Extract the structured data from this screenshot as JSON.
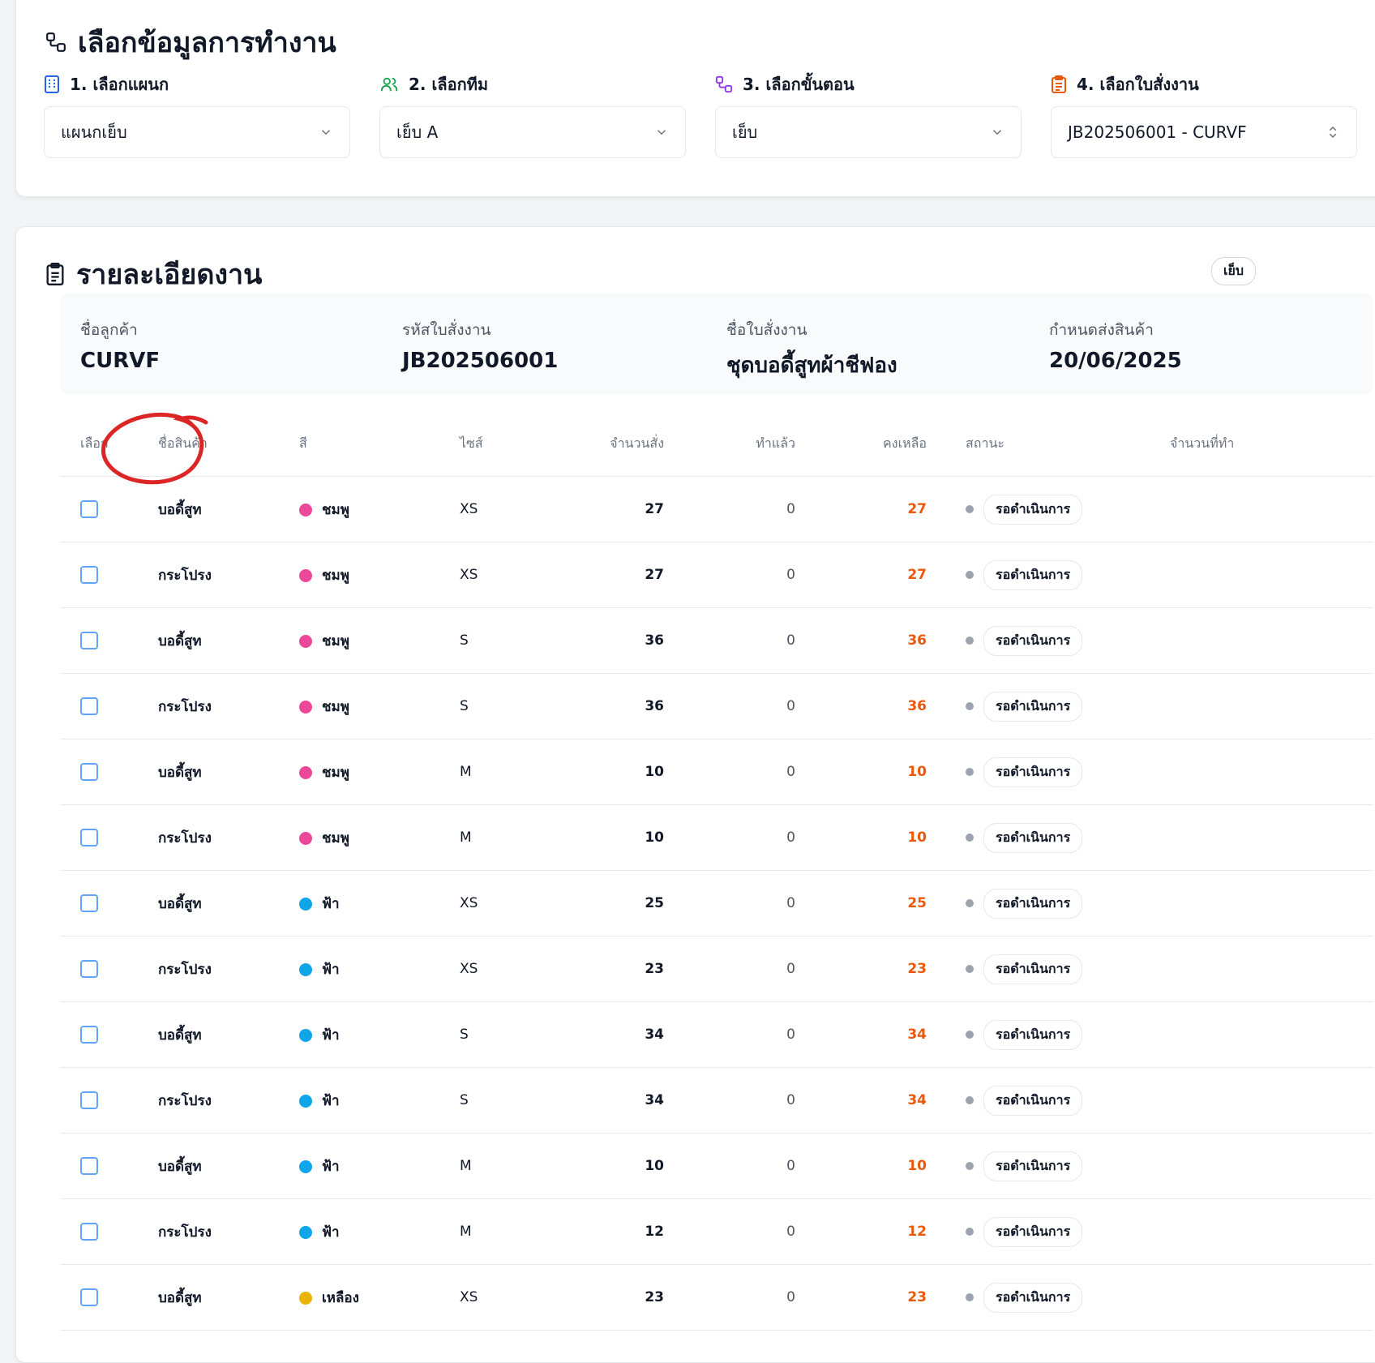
{
  "section1": {
    "title": "เลือกข้อมูลการทำงาน",
    "selects": [
      {
        "label": "1. เลือกแผนก",
        "value": "แผนกเย็บ",
        "icon": "building-icon",
        "color": "#2563eb"
      },
      {
        "label": "2. เลือกทีม",
        "value": "เย็บ A",
        "icon": "users-icon",
        "color": "#16a34a"
      },
      {
        "label": "3. เลือกขั้นตอน",
        "value": "เย็บ",
        "icon": "workflow-icon",
        "color": "#9333ea"
      },
      {
        "label": "4. เลือกใบสั่งงาน",
        "value": "JB202506001 - CURVF",
        "icon": "clipboard-icon",
        "color": "#ea580c"
      }
    ]
  },
  "section2": {
    "title": "รายละเอียดงาน",
    "badge": "เย็บ",
    "info": [
      {
        "label": "ชื่อลูกค้า",
        "value": "CURVF"
      },
      {
        "label": "รหัสใบสั่งงาน",
        "value": "JB202506001"
      },
      {
        "label": "ชื่อใบสั่งงาน",
        "value": "ชุดบอดี้สูทผ้าชีฟอง"
      },
      {
        "label": "กำหนดส่งสินค้า",
        "value": "20/06/2025"
      }
    ]
  },
  "table": {
    "headers": [
      "เลือก",
      "ชื่อสินค้า",
      "สี",
      "ไซส์",
      "จำนวนสั่ง",
      "ทำแล้ว",
      "คงเหลือ",
      "สถานะ",
      "จำนวนที่ทำ"
    ],
    "color_map": {
      "ชมพู": "#ec4899",
      "ฟ้า": "#0ea5e9",
      "เหลือง": "#eab308"
    },
    "rows": [
      {
        "name": "บอดี้สูท",
        "color": "ชมพู",
        "size": "XS",
        "ordered": "27",
        "done": "0",
        "remaining": "27",
        "status": "รอดำเนินการ"
      },
      {
        "name": "กระโปรง",
        "color": "ชมพู",
        "size": "XS",
        "ordered": "27",
        "done": "0",
        "remaining": "27",
        "status": "รอดำเนินการ"
      },
      {
        "name": "บอดี้สูท",
        "color": "ชมพู",
        "size": "S",
        "ordered": "36",
        "done": "0",
        "remaining": "36",
        "status": "รอดำเนินการ"
      },
      {
        "name": "กระโปรง",
        "color": "ชมพู",
        "size": "S",
        "ordered": "36",
        "done": "0",
        "remaining": "36",
        "status": "รอดำเนินการ"
      },
      {
        "name": "บอดี้สูท",
        "color": "ชมพู",
        "size": "M",
        "ordered": "10",
        "done": "0",
        "remaining": "10",
        "status": "รอดำเนินการ"
      },
      {
        "name": "กระโปรง",
        "color": "ชมพู",
        "size": "M",
        "ordered": "10",
        "done": "0",
        "remaining": "10",
        "status": "รอดำเนินการ"
      },
      {
        "name": "บอดี้สูท",
        "color": "ฟ้า",
        "size": "XS",
        "ordered": "25",
        "done": "0",
        "remaining": "25",
        "status": "รอดำเนินการ"
      },
      {
        "name": "กระโปรง",
        "color": "ฟ้า",
        "size": "XS",
        "ordered": "23",
        "done": "0",
        "remaining": "23",
        "status": "รอดำเนินการ"
      },
      {
        "name": "บอดี้สูท",
        "color": "ฟ้า",
        "size": "S",
        "ordered": "34",
        "done": "0",
        "remaining": "34",
        "status": "รอดำเนินการ"
      },
      {
        "name": "กระโปรง",
        "color": "ฟ้า",
        "size": "S",
        "ordered": "34",
        "done": "0",
        "remaining": "34",
        "status": "รอดำเนินการ"
      },
      {
        "name": "บอดี้สูท",
        "color": "ฟ้า",
        "size": "M",
        "ordered": "10",
        "done": "0",
        "remaining": "10",
        "status": "รอดำเนินการ"
      },
      {
        "name": "กระโปรง",
        "color": "ฟ้า",
        "size": "M",
        "ordered": "12",
        "done": "0",
        "remaining": "12",
        "status": "รอดำเนินการ"
      },
      {
        "name": "บอดี้สูท",
        "color": "เหลือง",
        "size": "XS",
        "ordered": "23",
        "done": "0",
        "remaining": "23",
        "status": "รอดำเนินการ"
      }
    ]
  },
  "annotation": {
    "color": "#dc2626",
    "target": "ชื่อสินค้า"
  }
}
